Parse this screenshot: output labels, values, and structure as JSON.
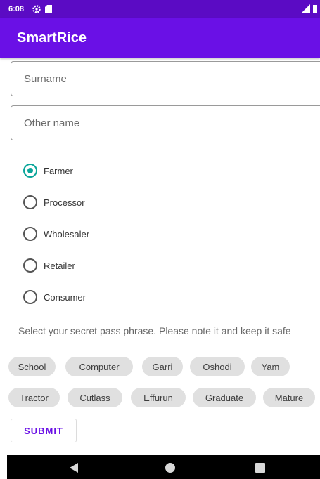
{
  "status_bar": {
    "time": "6:08",
    "icons": [
      "gear-icon",
      "sd-card-icon",
      "signal-icon",
      "battery-icon"
    ]
  },
  "app_bar": {
    "title": "SmartRice"
  },
  "form": {
    "surname": {
      "placeholder": "Surname",
      "value": ""
    },
    "other_name": {
      "placeholder": "Other name",
      "value": ""
    },
    "roles": [
      {
        "label": "Farmer",
        "checked": true
      },
      {
        "label": "Processor",
        "checked": false
      },
      {
        "label": "Wholesaler",
        "checked": false
      },
      {
        "label": "Retailer",
        "checked": false
      },
      {
        "label": "Consumer",
        "checked": false
      }
    ],
    "phrase_instruction": "Select your secret pass phrase. Please note it and keep it safe",
    "chips_row1": [
      "School",
      "Computer",
      "Garri",
      "Oshodi",
      "Yam"
    ],
    "chips_row2": [
      "Tractor",
      "Cutlass",
      "Effurun",
      "Graduate",
      "Mature"
    ],
    "submit_label": "SUBMIT"
  },
  "nav_bar": {
    "icons": [
      "back-icon",
      "home-icon",
      "recents-icon"
    ]
  },
  "colors": {
    "status_bar": "#5b0bc4",
    "app_bar": "#6a10e6",
    "radio_accent": "#0aa59a",
    "chip_bg": "#e0e0e0"
  }
}
